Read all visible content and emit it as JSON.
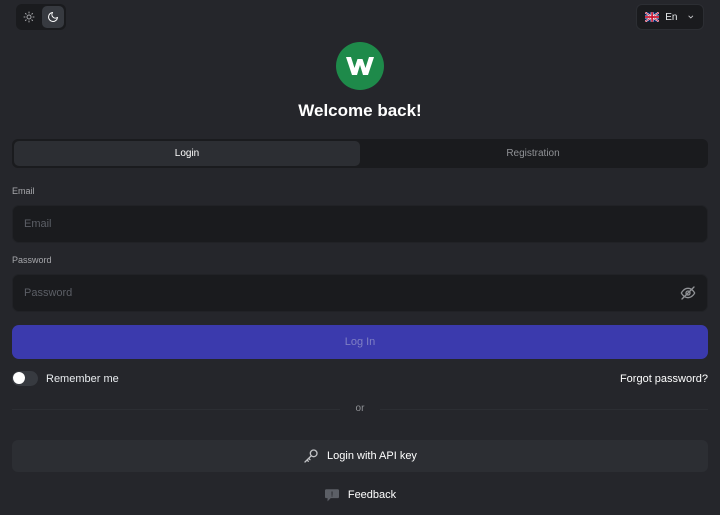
{
  "theme_toggle": {
    "light_icon": "sun-icon",
    "dark_icon": "moon-icon",
    "active": "dark"
  },
  "language": {
    "flag": "uk-flag-icon",
    "code": "En",
    "chevron_icon": "chevron-down-icon"
  },
  "logo": {
    "letter": "W",
    "color": "#1e8a4a"
  },
  "title": "Welcome back!",
  "tabs": [
    {
      "label": "Login",
      "active": true
    },
    {
      "label": "Registration",
      "active": false
    }
  ],
  "form": {
    "email_label": "Email",
    "email_placeholder": "Email",
    "email_value": "",
    "password_label": "Password",
    "password_placeholder": "Password",
    "password_value": "",
    "password_visibility_icon": "eye-off-icon",
    "submit_label": "Log In",
    "submit_color": "#3b3aad"
  },
  "remember_me": {
    "label": "Remember me",
    "checked": false
  },
  "forgot_password": "Forgot password?",
  "divider_text": "or",
  "api_login": {
    "label": "Login with API key",
    "icon": "key-icon"
  },
  "feedback": {
    "label": "Feedback",
    "icon": "chat-bubble-icon"
  }
}
